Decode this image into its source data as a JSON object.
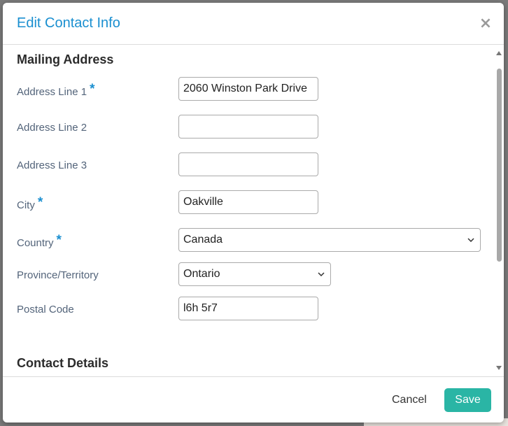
{
  "modal": {
    "title": "Edit Contact Info",
    "close_icon": "close-icon"
  },
  "colors": {
    "accent": "#1a8fd0",
    "save_button": "#2ab5a5",
    "label": "#53647a"
  },
  "mailing_address": {
    "heading": "Mailing Address",
    "required_marker": "*",
    "address_line_1": {
      "label": "Address Line 1",
      "value": "2060 Winston Park Drive",
      "required": true
    },
    "address_line_2": {
      "label": "Address Line 2",
      "value": "",
      "required": false
    },
    "address_line_3": {
      "label": "Address Line 3",
      "value": "",
      "required": false
    },
    "city": {
      "label": "City",
      "value": "Oakville",
      "required": true
    },
    "country": {
      "label": "Country",
      "value": "Canada",
      "required": true
    },
    "province": {
      "label": "Province/Territory",
      "value": "Ontario",
      "required": false
    },
    "postal_code": {
      "label": "Postal Code",
      "value": "l6h 5r7",
      "required": false
    }
  },
  "contact_details": {
    "heading": "Contact Details"
  },
  "footer": {
    "cancel_label": "Cancel",
    "save_label": "Save"
  }
}
